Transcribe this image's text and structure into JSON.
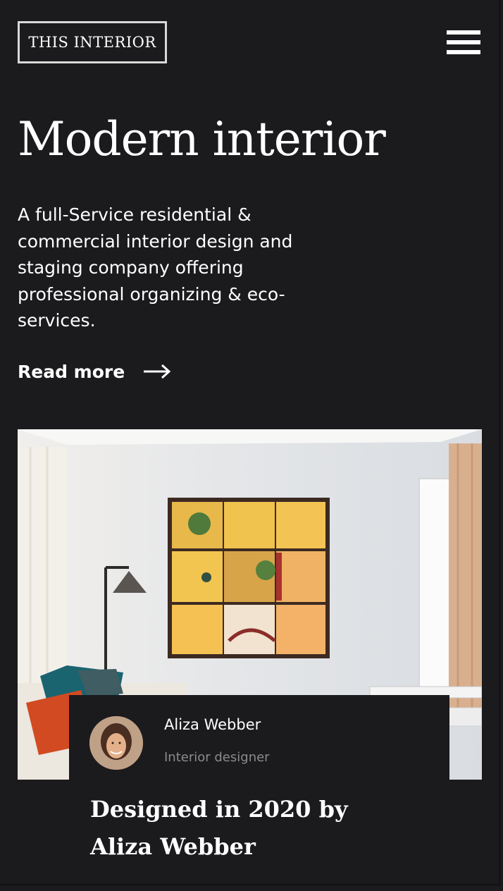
{
  "header": {
    "logo_text": "THIS INTERIOR",
    "menu_icon": "hamburger-menu-icon"
  },
  "hero": {
    "title": "Modern interior",
    "description": "A full-Service residential & commercial interior design and staging company offering professional organizing & eco-services.",
    "read_more_label": "Read more",
    "read_more_icon": "arrow-right-icon"
  },
  "feature": {
    "image_subject": "living room with yellow tiled wall art, floor lamp and cushions",
    "author": {
      "name": "Aliza Webber",
      "role": "Interior designer"
    },
    "title": "Designed in 2020 by Aliza Webber"
  },
  "colors": {
    "background": "#1b1a1d",
    "text": "#ffffff",
    "muted_text": "#8b8a8e",
    "logo_border": "#d8d8d8"
  }
}
